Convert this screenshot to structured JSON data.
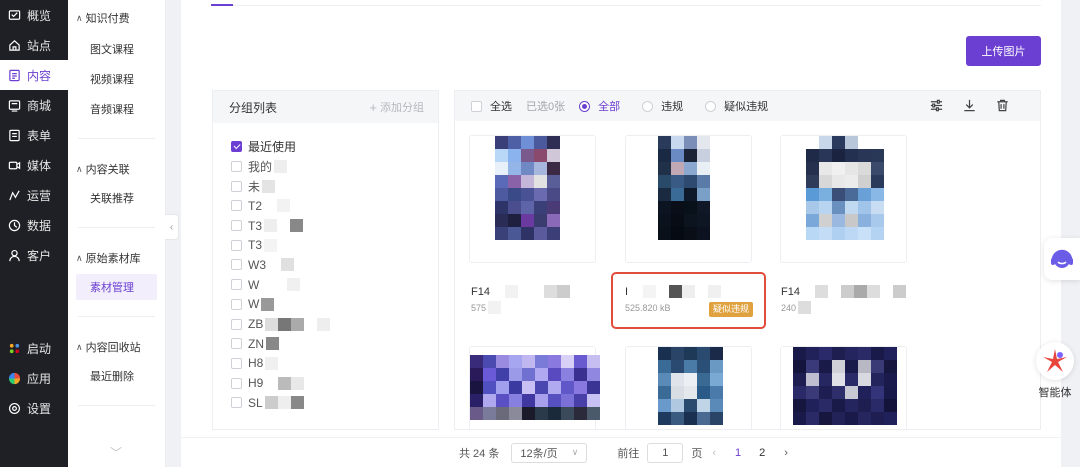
{
  "nav": {
    "items": [
      {
        "label": "概览",
        "icon": "overview-icon"
      },
      {
        "label": "站点",
        "icon": "home-icon"
      },
      {
        "label": "内容",
        "icon": "content-icon",
        "active": true
      },
      {
        "label": "商城",
        "icon": "shop-icon"
      },
      {
        "label": "表单",
        "icon": "form-icon"
      },
      {
        "label": "媒体",
        "icon": "media-icon"
      },
      {
        "label": "运营",
        "icon": "operation-icon"
      },
      {
        "label": "数据",
        "icon": "data-icon"
      },
      {
        "label": "客户",
        "icon": "customer-icon"
      }
    ],
    "bottom": [
      {
        "label": "启动",
        "icon": "launch-icon"
      },
      {
        "label": "应用",
        "icon": "apps-icon"
      },
      {
        "label": "设置",
        "icon": "settings-icon"
      }
    ]
  },
  "submenu": {
    "groups": [
      {
        "title": "知识付费",
        "items": [
          "图文课程",
          "视频课程",
          "音频课程"
        ]
      },
      {
        "title": "内容关联",
        "items": [
          "关联推荐"
        ]
      },
      {
        "title": "原始素材库",
        "items": [
          "素材管理"
        ],
        "active": "素材管理"
      },
      {
        "title": "内容回收站",
        "items": [
          "最近删除"
        ]
      }
    ]
  },
  "toolbar": {
    "upload_label": "上传图片"
  },
  "groups": {
    "title": "分组列表",
    "add_label": "添加分组",
    "items": [
      "最近使用",
      "我的",
      "未",
      "T2",
      "T3",
      "T3",
      "W3",
      "W",
      "W",
      "ZB",
      "ZN",
      "H8",
      "H9",
      "SL"
    ]
  },
  "filters": {
    "select_all": "全选",
    "selected_count": "已选0张",
    "all": "全部",
    "violation": "违规",
    "suspected": "疑似违规"
  },
  "files": {
    "cards": [
      {
        "name": "F14",
        "size": "575"
      },
      {
        "name": "I",
        "size": "525.820 kB",
        "flag": "疑似违规"
      },
      {
        "name": "F14",
        "size": "240"
      }
    ]
  },
  "pagination": {
    "total": "共 24 条",
    "page_size": "12条/页",
    "goto_label": "前往",
    "goto_value": "1",
    "page_unit": "页",
    "pages": [
      "1",
      "2"
    ],
    "current": "1"
  },
  "floaters": {
    "agent_label": "智能体"
  },
  "colors": {
    "accent": "#6b3fd1",
    "nav_bg": "#1f2025",
    "warning": "#e0a23f",
    "highlight": "#e04d3c"
  }
}
